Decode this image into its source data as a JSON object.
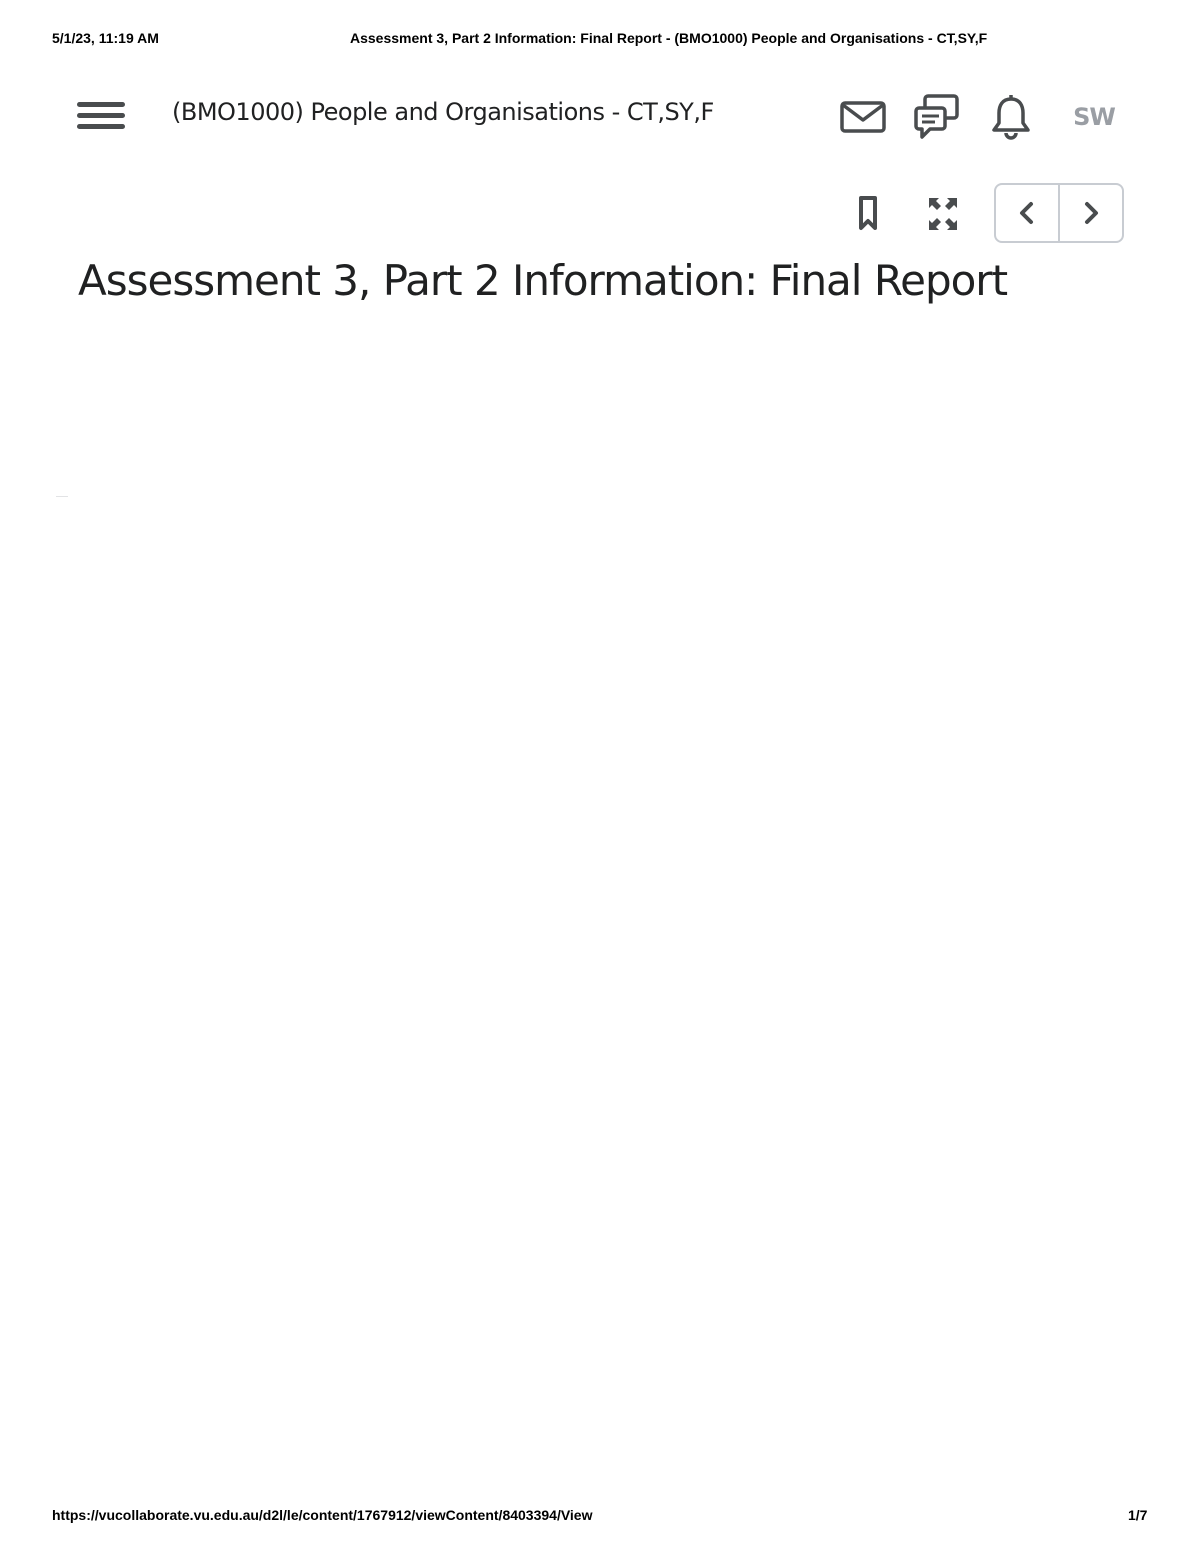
{
  "print_header": {
    "datetime": "5/1/23, 11:19 AM",
    "document_title": "Assessment 3, Part 2 Information: Final Report - (BMO1000) People and Organisations - CT,SY,F"
  },
  "navbar": {
    "menu_icon": "hamburger-menu-icon",
    "course_title": "(BMO1000) People and Organisations - CT,SY,F",
    "icons": [
      "mail-icon",
      "chat-icon",
      "bell-icon"
    ],
    "avatar_initials": "SW",
    "avatar_color": "#9a9ea4"
  },
  "toolbar": {
    "icons": [
      "bookmark-icon",
      "fullscreen-icon",
      "chevron-left-icon",
      "chevron-right-icon"
    ]
  },
  "main": {
    "title": "Assessment 3, Part 2 Information: Final Report"
  },
  "print_footer": {
    "url": "https://vucollaborate.vu.edu.au/d2l/le/content/1767912/viewContent/8403394/View",
    "page_number": "1/7"
  },
  "colors": {
    "text": "#202122",
    "icon": "#494c4e",
    "border": "#c8ccd2",
    "background": "#ffffff"
  }
}
